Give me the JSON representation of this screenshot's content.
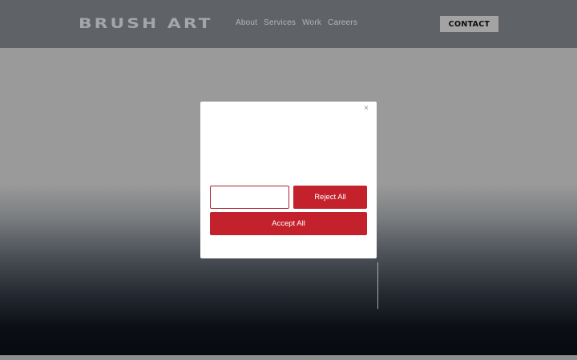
{
  "header": {
    "logo": "BRUSH ART",
    "nav": [
      "About",
      "Services",
      "Work",
      "Careers"
    ],
    "contact_label": "CONTACT"
  },
  "cookie_modal": {
    "close_icon": "close-icon",
    "close_glyph": "×",
    "outline_button_label": "",
    "reject_label": "Reject All",
    "accept_label": "Accept All"
  },
  "colors": {
    "header_bg": "#5f6266",
    "hero_top": "#9a9a9a",
    "hero_bottom": "#070a0f",
    "accent_red": "#c3222d",
    "contact_bg": "#a3a3a3"
  }
}
